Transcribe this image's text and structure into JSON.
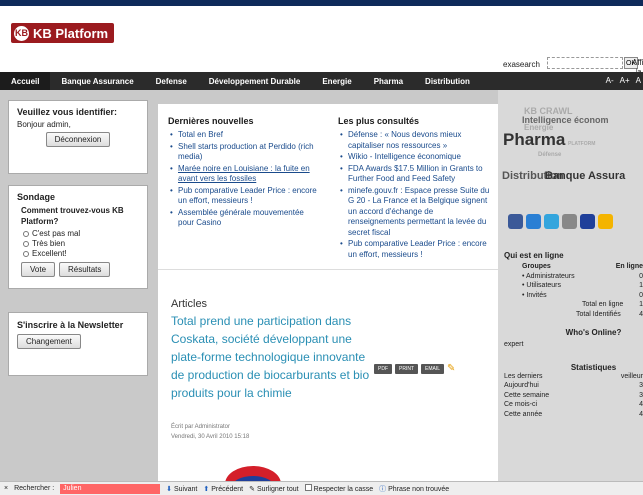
{
  "header": {
    "logo_text": "KB Platform",
    "logo_badge": "KB",
    "search_label": "exasearch",
    "search_value": "",
    "ok_label": "OK",
    "affich": "Affic",
    "la": "la"
  },
  "nav": {
    "items": [
      "Accueil",
      "Banque Assurance",
      "Defense",
      "Développement Durable",
      "Energie",
      "Pharma",
      "Distribution"
    ],
    "font_controls": [
      "A-",
      "A+",
      "A"
    ]
  },
  "login": {
    "title": "Veuillez vous identifier:",
    "greeting": "Bonjour admin,",
    "logout_button": "Déconnexion"
  },
  "poll": {
    "title": "Sondage",
    "question": "Comment trouvez-vous KB Platform?",
    "options": [
      "C'est pas mal",
      "Très bien",
      "Excellent!"
    ],
    "vote_button": "Vote",
    "results_button": "Résultats"
  },
  "newsletter": {
    "title": "S'inscrire à la Newsletter",
    "button": "Changement"
  },
  "latest": {
    "title": "Dernières nouvelles",
    "items": [
      "Total en Bref",
      "Shell starts production at Perdido (rich media)",
      "Marée noire en Louisiane : la fuite en avant vers les fossiles",
      "Pub comparative Leader Price : encore un effort, messieurs !",
      "Assemblée générale mouvementée pour Casino"
    ]
  },
  "popular": {
    "title": "Les plus consultés",
    "items": [
      "Défense : « Nous devons mieux capitaliser nos ressources »",
      "Wikio - Intelligence économique",
      "FDA Awards $17.5 Million in Grants to Further Food and Feed Safety",
      "minefe.gouv.fr : Espace presse Suite du G 20 - La France et la Belgique signent un accord d'échange de renseignements permettant la levée du secret fiscal",
      "Pub comparative Leader Price : encore un effort, messieurs !"
    ]
  },
  "article": {
    "heading": "Articles",
    "title": "Total prend une participation dans Coskata, société développant une plate-forme technologique innovante de production de biocarburants et bio produits pour la chimie",
    "author": "Écrit par Administrator",
    "date": "Vendredi, 30 Avril 2010 15:18",
    "tools": [
      "PDF",
      "PRINT",
      "EMAIL"
    ]
  },
  "right_brands": {
    "kb_crawl": "KB CRAWL",
    "intelligence": "Intelligence économ",
    "energie": "Energie",
    "pharma": "Pharma",
    "pharma_sub": "PLATFORM",
    "defense": "Défense",
    "distribution": "Distribution",
    "banque": "Banque Assura"
  },
  "online": {
    "title": "Qui est en ligne",
    "col_groups": "Groupes",
    "col_online": "En ligne",
    "rows": [
      {
        "label": "• Administrateurs",
        "value": "0"
      },
      {
        "label": "• Utilisateurs",
        "value": "1"
      },
      {
        "label": "• Invités",
        "value": "0"
      }
    ],
    "total_online_label": "Total en ligne",
    "total_online": "1",
    "total_identified_label": "Total Identifiés",
    "total_identified": "4"
  },
  "whos_online": {
    "title": "Who's Online?",
    "user": "expert"
  },
  "stats": {
    "title": "Statistiques",
    "header_left": "Les derniers",
    "header_right": "veilleur",
    "rows": [
      {
        "label": "Aujourd'hui",
        "value": "3"
      },
      {
        "label": "Cette semaine",
        "value": "3"
      },
      {
        "label": "Ce mois-ci",
        "value": "4"
      },
      {
        "label": "Cette année",
        "value": "4"
      }
    ]
  },
  "findbar": {
    "close": "×",
    "label": "Rechercher :",
    "value": "Julien",
    "next": "Suivant",
    "prev": "Précédent",
    "highlight": "Surligner tout",
    "match_case": "Respecter la casse",
    "status": "Phrase non trouvée"
  },
  "colors": {
    "accent_blue": "#2a8fb4",
    "nav_bg": "#2b2b2b",
    "logo_red": "#9b1b1f",
    "find_error": "#ff6666"
  }
}
